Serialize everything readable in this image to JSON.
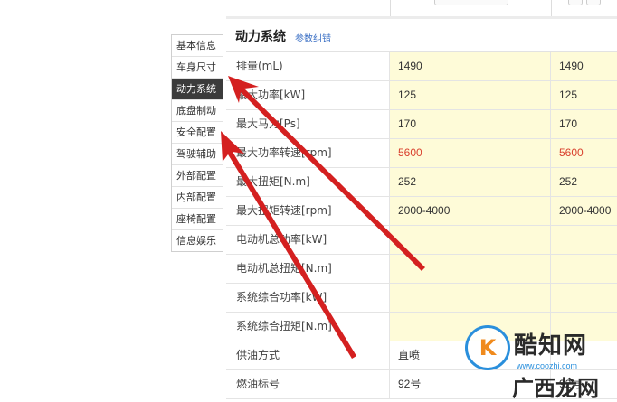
{
  "sidenav": {
    "items": [
      {
        "label": "基本信息"
      },
      {
        "label": "车身尺寸"
      },
      {
        "label": "动力系统",
        "active": true
      },
      {
        "label": "底盘制动"
      },
      {
        "label": "安全配置"
      },
      {
        "label": "驾驶辅助"
      },
      {
        "label": "外部配置"
      },
      {
        "label": "内部配置"
      },
      {
        "label": "座椅配置"
      },
      {
        "label": "信息娱乐"
      }
    ]
  },
  "section": {
    "title": "动力系统",
    "link": "参数纠错"
  },
  "table": {
    "rows": [
      {
        "label": "排量(mL)",
        "v1": "1490",
        "v2": "1490"
      },
      {
        "label": "最大功率[kW]",
        "v1": "125",
        "v2": "125"
      },
      {
        "label": "最大马力[Ps]",
        "v1": "170",
        "v2": "170"
      },
      {
        "label": "最大功率转速[rpm]",
        "v1": "5600",
        "v2": "5600",
        "highlight": "red"
      },
      {
        "label": "最大扭矩[N.m]",
        "v1": "252",
        "v2": "252"
      },
      {
        "label": "最大扭矩转速[rpm]",
        "v1": "2000-4000",
        "v2": "2000-4000"
      },
      {
        "label": "电动机总功率[kW]",
        "v1": "",
        "v2": ""
      },
      {
        "label": "电动机总扭矩[N.m]",
        "v1": "",
        "v2": ""
      },
      {
        "label": "系统综合功率[kW]",
        "v1": "",
        "v2": ""
      },
      {
        "label": "系统综合扭矩[N.m]",
        "v1": "",
        "v2": ""
      },
      {
        "label": "供油方式",
        "v1": "直喷",
        "v2": ""
      },
      {
        "label": "燃油标号",
        "v1": "92号",
        "v2": "92号"
      }
    ]
  },
  "watermark": {
    "letter": "K",
    "name": "酷知网",
    "url": "www.coozhi.com",
    "sub": "广西龙网"
  },
  "colors": {
    "arrow": "#d42020",
    "highlight_cell": "#fefbd8",
    "red_value": "#d9412e",
    "active_nav": "#3b3b3b"
  }
}
